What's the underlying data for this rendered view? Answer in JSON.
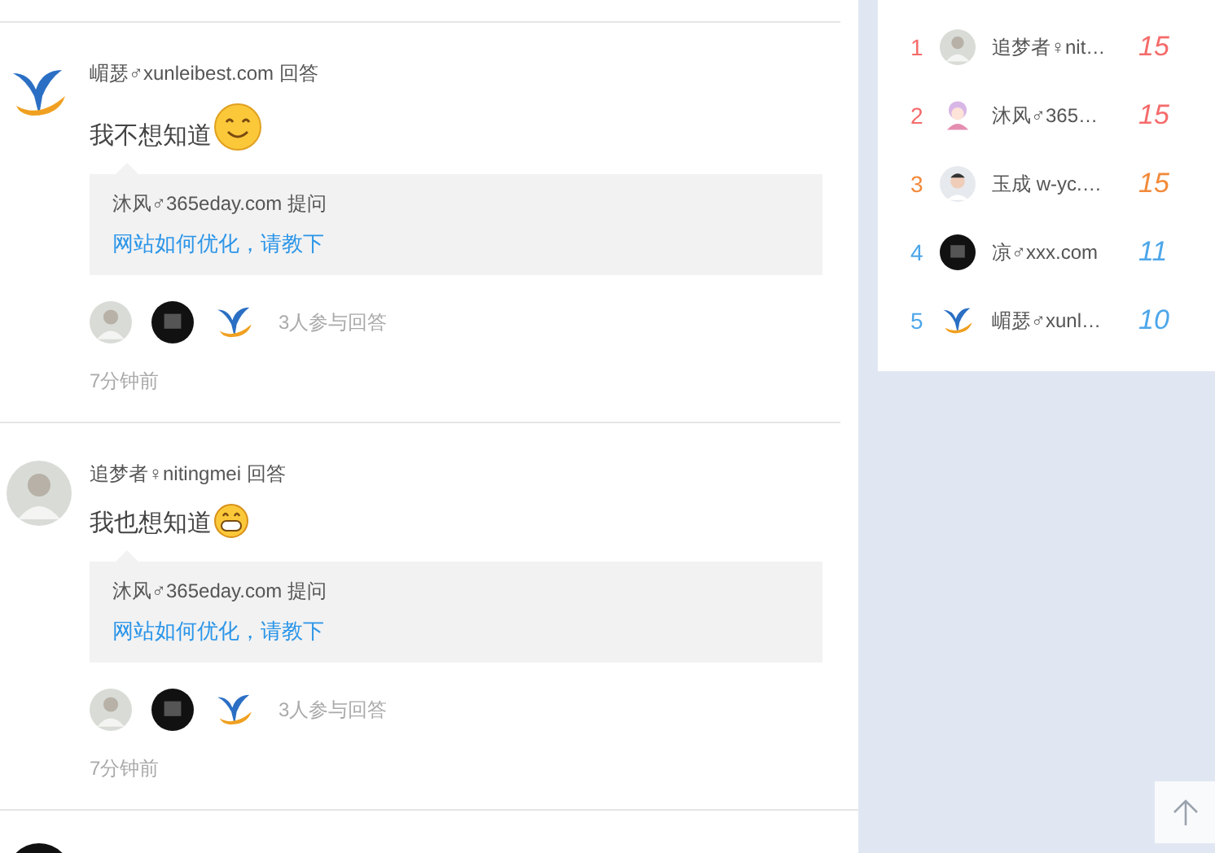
{
  "answers": [
    {
      "avatar": {
        "kind": "logo"
      },
      "author": "嵋瑟♂xunleibest.com",
      "action": "回答",
      "content": "我不想知道",
      "emoji": {
        "kind": "smile"
      },
      "question": {
        "asker": "沐风♂365eday.com",
        "action": "提问",
        "title": "网站如何优化，请教下"
      },
      "participants": [
        {
          "kind": "photo"
        },
        {
          "kind": "dark"
        },
        {
          "kind": "logo"
        }
      ],
      "count": "3人参与回答",
      "time": "7分钟前"
    },
    {
      "avatar": {
        "kind": "photo"
      },
      "author": "追梦者♀nitingmei",
      "action": "回答",
      "content": "我也想知道",
      "emoji": {
        "kind": "grin"
      },
      "question": {
        "asker": "沐风♂365eday.com",
        "action": "提问",
        "title": "网站如何优化，请教下"
      },
      "participants": [
        {
          "kind": "photo"
        },
        {
          "kind": "dark"
        },
        {
          "kind": "logo"
        }
      ],
      "count": "3人参与回答",
      "time": "7分钟前"
    }
  ],
  "next_avatar": {
    "kind": "dark"
  },
  "ranking": [
    {
      "rank": "1",
      "avatar": {
        "kind": "photo"
      },
      "name": "追梦者♀nit…",
      "score": "15",
      "color": "#f56b6b"
    },
    {
      "rank": "2",
      "avatar": {
        "kind": "cartoon"
      },
      "name": "沐风♂365…",
      "score": "15",
      "color": "#f56b6b"
    },
    {
      "rank": "3",
      "avatar": {
        "kind": "face"
      },
      "name": "玉成 w-yc.…",
      "score": "15",
      "color": "#f28a3a"
    },
    {
      "rank": "4",
      "avatar": {
        "kind": "dark"
      },
      "name": "凉♂xxx.com",
      "score": "11",
      "color": "#4ca6ea"
    },
    {
      "rank": "5",
      "avatar": {
        "kind": "logo"
      },
      "name": "嵋瑟♂xunl…",
      "score": "10",
      "color": "#4ca6ea"
    }
  ]
}
